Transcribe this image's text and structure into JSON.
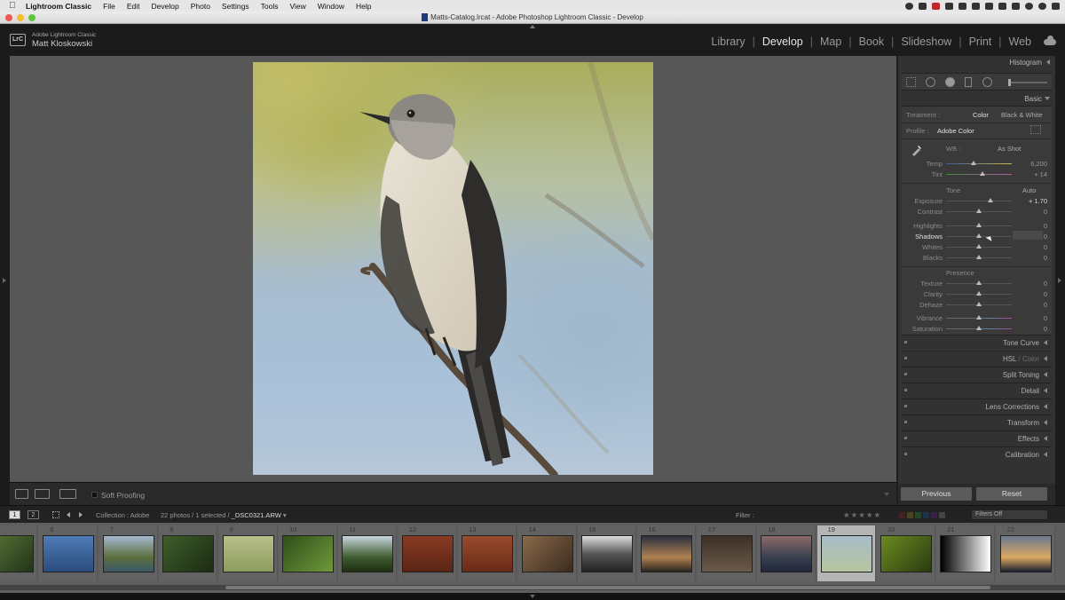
{
  "menubar": {
    "app_name": "Lightroom Classic",
    "items": [
      "File",
      "Edit",
      "Develop",
      "Photo",
      "Settings",
      "Tools",
      "View",
      "Window",
      "Help"
    ]
  },
  "window": {
    "title": "Matts-Catalog.lrcat - Adobe Photoshop Lightroom Classic - Develop"
  },
  "identity": {
    "badge": "LrC",
    "app": "Adobe Lightroom Classic",
    "user": "Matt Kloskowski"
  },
  "modules": {
    "items": [
      "Library",
      "Develop",
      "Map",
      "Book",
      "Slideshow",
      "Print",
      "Web"
    ],
    "active": "Develop"
  },
  "toolbar": {
    "soft_proofing": "Soft Proofing"
  },
  "right_panel": {
    "histogram": "Histogram",
    "basic": "Basic",
    "treatment": {
      "label": "Treatment :",
      "color": "Color",
      "bw": "Black & White"
    },
    "profile": {
      "label": "Profile :",
      "value": "Adobe Color"
    },
    "wb": {
      "label": "WB :",
      "value": "As Shot"
    },
    "temp": {
      "label": "Temp",
      "value": "6,200",
      "pos": 0.42
    },
    "tint": {
      "label": "Tint",
      "value": "+ 14",
      "pos": 0.55
    },
    "tone": {
      "label": "Tone",
      "auto": "Auto"
    },
    "exposure": {
      "label": "Exposure",
      "value": "+ 1.70",
      "pos": 0.67
    },
    "contrast": {
      "label": "Contrast",
      "value": "0",
      "pos": 0.5
    },
    "highlights": {
      "label": "Highlights",
      "value": "0",
      "pos": 0.5
    },
    "shadows": {
      "label": "Shadows",
      "value": "0",
      "pos": 0.5
    },
    "whites": {
      "label": "Whites",
      "value": "0",
      "pos": 0.5
    },
    "blacks": {
      "label": "Blacks",
      "value": "0",
      "pos": 0.5
    },
    "presence": {
      "label": "Presence"
    },
    "texture": {
      "label": "Texture",
      "value": "0",
      "pos": 0.5
    },
    "clarity": {
      "label": "Clarity",
      "value": "0",
      "pos": 0.5
    },
    "dehaze": {
      "label": "Dehaze",
      "value": "0",
      "pos": 0.5
    },
    "vibrance": {
      "label": "Vibrance",
      "value": "0",
      "pos": 0.5
    },
    "saturation": {
      "label": "Saturation",
      "value": "0",
      "pos": 0.5
    },
    "tone_curve": "Tone Curve",
    "hsl": "HSL",
    "hsl_color": "/ Color",
    "split_toning": "Split Toning",
    "detail": "Detail",
    "lens_corrections": "Lens Corrections",
    "transform": "Transform",
    "effects": "Effects",
    "calibration": "Calibration",
    "previous": "Previous",
    "reset": "Reset"
  },
  "filmstrip_header": {
    "screen1": "1",
    "screen2": "2",
    "source": "Collection : Adobe",
    "count": "22 photos / 1 selected /",
    "filename": "_DSC0321.ARW",
    "filter_label": "Filter :",
    "stars": "★★★★★",
    "filters_off": "Filters Off"
  },
  "filmstrip": {
    "numbers": [
      "",
      "6",
      "7",
      "8",
      "9",
      "10",
      "11",
      "12",
      "13",
      "14",
      "15",
      "16",
      "17",
      "18",
      "19",
      "20",
      "21",
      "22"
    ],
    "selected_index": 14
  },
  "colors": {
    "accent_active": "#e6e6e6",
    "panel_bg": "#323232",
    "workspace_bg": "#575757"
  }
}
